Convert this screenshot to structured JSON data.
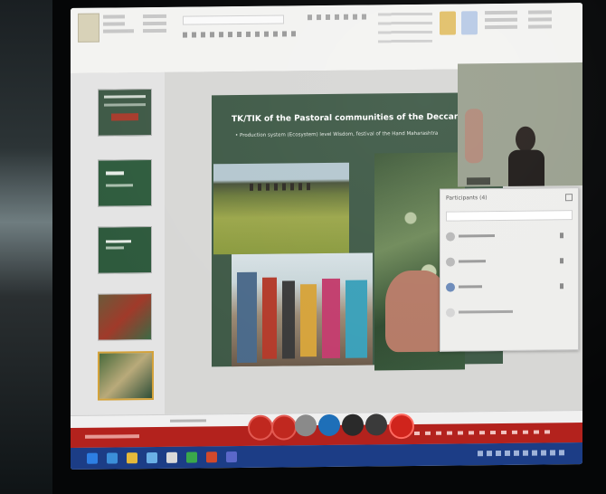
{
  "slide": {
    "title": "TK/TIK of the Pastoral communities of the Deccan Plat",
    "bullet": "• Production system (Ecosystem) level Wisdom, festival of the Hand Maharashtra"
  },
  "participants": {
    "title": "Participants (4)"
  },
  "colors": {
    "slide_bg": "#3f5a47",
    "call_bar": "#b3221d",
    "taskbar": "#1c3d86",
    "ribbon": "#f3f3f1"
  },
  "icons": [
    "mic-icon",
    "video-icon",
    "share-icon",
    "chat-icon",
    "more-icon",
    "hangup-icon"
  ]
}
